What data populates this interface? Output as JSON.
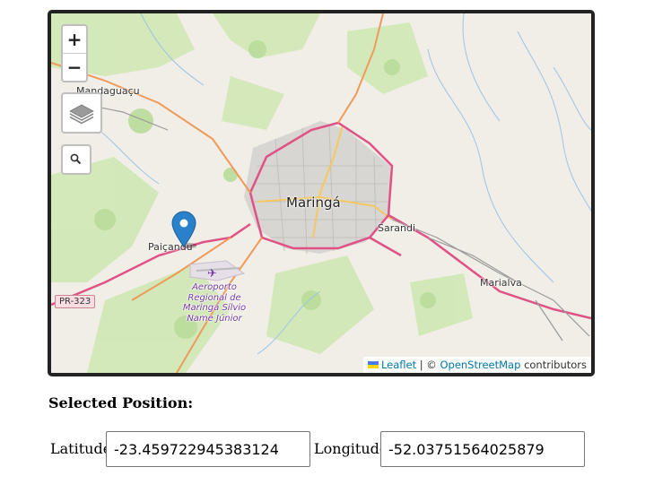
{
  "map": {
    "labels": {
      "city_main": "Maringá",
      "town_nw": "Mandaguaçu",
      "town_w": "Paiçandu",
      "town_e": "Sarandi",
      "town_se": "Marialva",
      "airport": "Aeroporto Regional de Maringá Sílvio Name Júnior",
      "road_shield": "PR-323"
    },
    "controls": {
      "zoom_in": "+",
      "zoom_out": "−"
    },
    "attribution": {
      "leaflet": "Leaflet",
      "separator": "| ©",
      "osm": "OpenStreetMap",
      "suffix": "contributors"
    },
    "marker_color": "#2a81cb"
  },
  "form": {
    "title": "Selected Position:",
    "latitude_label": "Latitude:",
    "latitude_value": "-23.459722945383124",
    "longitude_label": "Longitude:",
    "longitude_value": "-52.03751564025879"
  }
}
